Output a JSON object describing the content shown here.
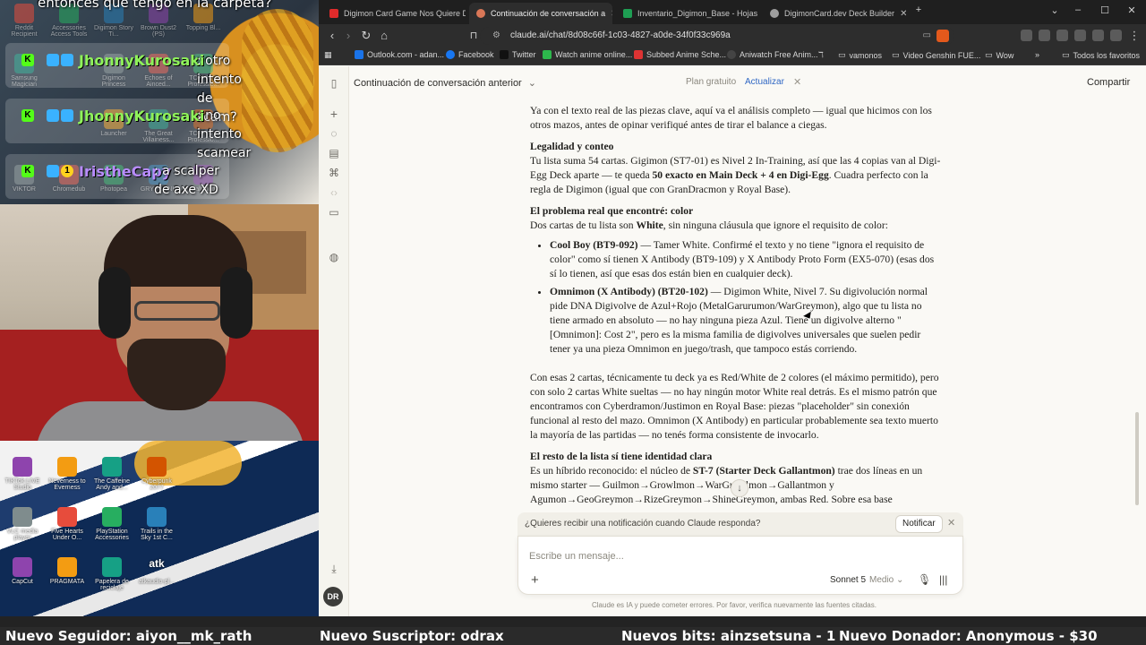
{
  "overlay": {
    "chat": [
      {
        "user": "",
        "message": "entonces que tengo en la carpeta?"
      },
      {
        "user": "JhonnyKurosaki",
        "message": ": otro intento de scam?"
      },
      {
        "user": "JhonnyKurosaki",
        "message": ": no intento scamear"
      },
      {
        "user": "IristheCapy",
        "message": ": a scalper de axe XD"
      }
    ],
    "desktop_icons_top": [
      [
        "Reddit Recipient",
        "Accessories Access Tools",
        "Digimon Story Ti...",
        "Brown Dust2 (PS)",
        "Topping Bl..."
      ],
      [
        "Samsung Magician",
        "",
        "Digimon Princess",
        "Echoes of Ainced...",
        "TOPPING Professio..."
      ],
      [
        "",
        "",
        "Launcher",
        "The Great Villainess...",
        "TOPPING Professio..."
      ],
      [
        "VIKTOR",
        "Chromedub",
        "Photopea",
        "GRYPHLINK",
        "Palworld"
      ]
    ],
    "desktop_icons_bottom": [
      [
        "TIKTok LIVE Studio",
        "Neverness to Everness",
        "The Caffeine Andy and...",
        "Cyberpunk 2077"
      ],
      [
        "VLC media player",
        "Five Hearts Under O...",
        "PlayStation Accessories",
        "Trails in the Sky 1st C..."
      ],
      [
        "CapCut",
        "PRAGMATA",
        "Papelera de reciclaje",
        "atkaudio-pl..."
      ]
    ],
    "desktop_misc": "atk"
  },
  "browser": {
    "tabs": [
      {
        "label": "Digimon Card Game Nos Quiere Dej",
        "color": "#e02b2b",
        "active": false
      },
      {
        "label": "Continuación de conversación a",
        "color": "#d97757",
        "active": true
      },
      {
        "label": "Inventario_Digimon_Base - Hojas de",
        "color": "#1e9e53",
        "active": false
      },
      {
        "label": "DigimonCard.dev Deck Builder",
        "color": "#9e9e9e",
        "active": false
      }
    ],
    "new_tab": "+",
    "url": "claude.ai/chat/8d08c66f-1c03-4827-a0de-34f0f33c969a",
    "bookmarks": [
      {
        "label": "Outlook.com - adan...",
        "color": "#1a73e8"
      },
      {
        "label": "Facebook",
        "color": "#1877f2"
      },
      {
        "label": "Twitter",
        "color": "#111"
      },
      {
        "label": "Watch anime online...",
        "color": "#2db84c"
      },
      {
        "label": "Subbed Anime Sche...",
        "color": "#d33"
      },
      {
        "label": "Aniwatch Free Anim...",
        "color": "#444"
      },
      {
        "label": "vamonos",
        "color": "folder"
      },
      {
        "label": "Video Genshin FUE...",
        "color": "folder"
      },
      {
        "label": "Wow",
        "color": "folder"
      },
      {
        "label": "Todos los favoritos",
        "color": "folder"
      }
    ],
    "more_bookmarks": "»"
  },
  "app": {
    "conversation_title": "Continuación de conversación anterior",
    "plan": "Plan gratuito",
    "upgrade": "Actualizar",
    "share": "Compartir",
    "avatar": "DR",
    "message": {
      "intro": "Ya con el texto real de las piezas clave, aquí va el análisis completo — igual que hicimos con los otros mazos, antes de opinar verifiqué antes de tirar el balance a ciegas.",
      "h1": "Legalidad y conteo",
      "p1_a": "Tu lista suma 54 cartas. Gigimon (ST7-01) es Nivel 2 In-Training, así que las 4 copias van al Digi-Egg Deck aparte — te queda ",
      "p1_b": "50 exacto en Main Deck + 4 en Digi-Egg",
      "p1_c": ". Cuadra perfecto con la regla de Digimon (igual que con GranDracmon y Royal Base).",
      "h2": "El problema real que encontré: color",
      "p2_a": "Dos cartas de tu lista son ",
      "p2_b": "White",
      "p2_c": ", sin ninguna cláusula que ignore el requisito de color:",
      "li1_a": "Cool Boy (BT9-092)",
      "li1_b": " — Tamer White. Confirmé el texto y no tiene \"ignora el requisito de color\" como sí tienen X Antibody (BT9-109) y X Antibody Proto Form (EX5-070) (esas dos sí lo tienen, así que esas dos están bien en cualquier deck).",
      "li2_a": "Omnimon (X Antibody) (BT20-102)",
      "li2_b": " — Digimon White, Nivel 7. Su digivolución normal pide DNA Digivolve de Azul+Rojo (MetalGarurumon/WarGreymon), algo que tu lista no tiene armado en absoluto — no hay ninguna pieza Azul. Tiene un digivolve alterno \"[Omnimon]: Cost 2\", pero es la misma familia de digivolves universales que suelen pedir tener ya una pieza Omnimon en juego/trash, que tampoco estás corriendo.",
      "p3": "Con esas 2 cartas, técnicamente tu deck ya es Red/White de 2 colores (el máximo permitido), pero con solo 2 cartas White sueltas — no hay ningún motor White real detrás. Es el mismo patrón que encontramos con Cyberdramon/Justimon en Royal Base: piezas \"placeholder\" sin conexión funcional al resto del mazo. Omnimon (X Antibody) en particular probablemente sea texto muerto la mayoría de las partidas — no tenés forma consistente de invocarlo.",
      "h3": "El resto de la lista sí tiene identidad clara",
      "p4_a": "Es un híbrido reconocido: el núcleo de ",
      "p4_b": "ST-7 (Starter Deck Gallantmon)",
      "p4_c": " trae dos líneas en un mismo starter — Guilmon→Growlmon→WarGrowlmon→Gallantmon y Agumon→GeoGreymon→RizeGreymon→ShineGreymon, ambas Red. Sobre esa base"
    },
    "notification_prompt": "¿Quieres recibir una notificación cuando Claude responda?",
    "notify_button": "Notificar",
    "composer_placeholder": "Escribe un mensaje...",
    "model": "Sonnet 5",
    "model_mode": "Medio",
    "disclaimer": "Claude es IA y puede cometer errores. Por favor, verifica nuevamente las fuentes citadas."
  },
  "ticker": {
    "follower": "Nuevo Seguidor: aiyon__mk_rath",
    "subscriber": "Nuevo Suscriptor: odrax",
    "bits": "Nuevos bits: ainzsetsuna - 1",
    "donor": "Nuevo Donador: Anonymous - $30"
  }
}
